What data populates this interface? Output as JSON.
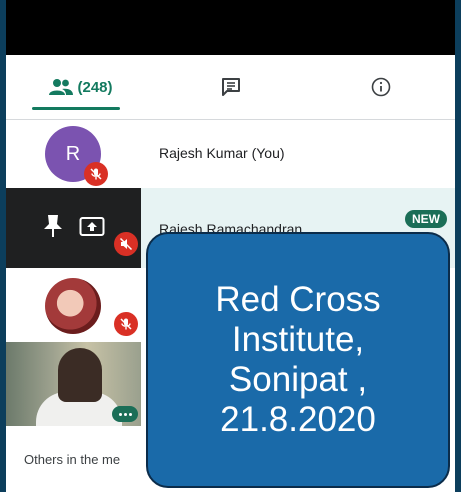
{
  "colors": {
    "accent": "#137a5f",
    "mute_red": "#d93025",
    "badge": "#1b6e57",
    "overlay": "#1a6aa9",
    "outer": "#0c3e5c"
  },
  "tabs": {
    "people": {
      "icon": "people-icon",
      "count": "(248)"
    },
    "chat": {
      "icon": "chat-icon"
    },
    "info": {
      "icon": "info-icon"
    }
  },
  "participants": [
    {
      "initial": "R",
      "name": "Rajesh Kumar (You)",
      "muted": true
    },
    {
      "name": "Rajesh Ramachandran",
      "badge": "NEW",
      "icons": [
        "pin-icon",
        "present-screen-icon"
      ],
      "muted": true
    },
    {
      "avatar": "photo",
      "muted": true
    },
    {
      "video": true
    }
  ],
  "others_label": "Others in the me",
  "overlay": {
    "line1": "Red Cross",
    "line2": "Institute,",
    "line3": "Sonipat ,",
    "line4": "21.8.2020"
  }
}
